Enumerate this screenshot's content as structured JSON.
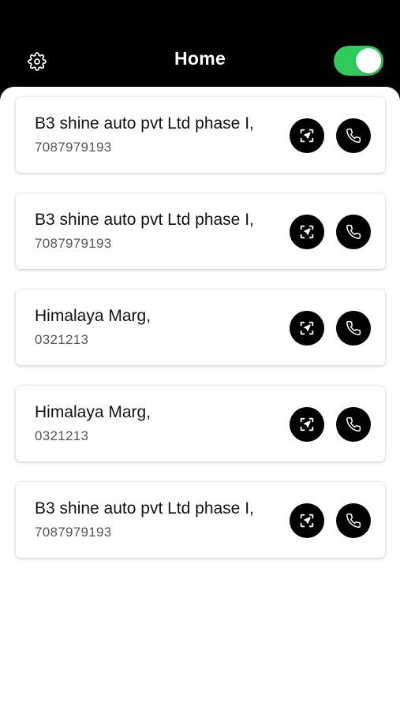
{
  "header": {
    "title": "Home",
    "settings_icon": "gear-icon",
    "toggle_on": true,
    "toggle_color": "#2fc95c"
  },
  "cards": [
    {
      "name": "B3 shine auto pvt Ltd phase I,",
      "phone": "7087979193",
      "nav_icon": "navigate-icon",
      "call_icon": "phone-icon"
    },
    {
      "name": "B3 shine auto pvt Ltd phase I,",
      "phone": "7087979193",
      "nav_icon": "navigate-icon",
      "call_icon": "phone-icon"
    },
    {
      "name": "Himalaya Marg,",
      "phone": "0321213",
      "nav_icon": "navigate-icon",
      "call_icon": "phone-icon"
    },
    {
      "name": "Himalaya Marg,",
      "phone": "0321213",
      "nav_icon": "navigate-icon",
      "call_icon": "phone-icon"
    },
    {
      "name": "B3 shine auto pvt Ltd phase I,",
      "phone": "7087979193",
      "nav_icon": "navigate-icon",
      "call_icon": "phone-icon"
    }
  ]
}
